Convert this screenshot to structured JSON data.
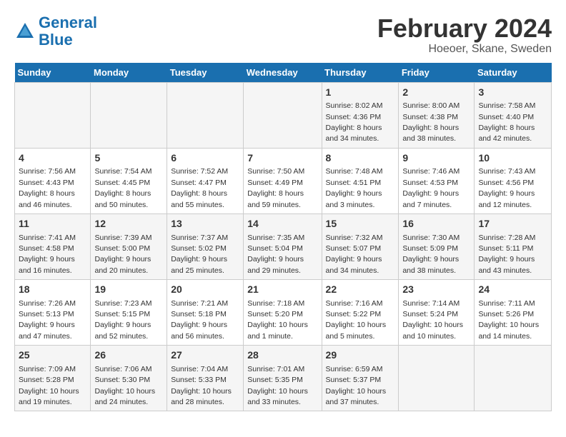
{
  "header": {
    "logo_line1": "General",
    "logo_line2": "Blue",
    "title": "February 2024",
    "subtitle": "Hoeoer, Skane, Sweden"
  },
  "weekdays": [
    "Sunday",
    "Monday",
    "Tuesday",
    "Wednesday",
    "Thursday",
    "Friday",
    "Saturday"
  ],
  "weeks": [
    [
      {
        "day": "",
        "sunrise": "",
        "sunset": "",
        "daylight": ""
      },
      {
        "day": "",
        "sunrise": "",
        "sunset": "",
        "daylight": ""
      },
      {
        "day": "",
        "sunrise": "",
        "sunset": "",
        "daylight": ""
      },
      {
        "day": "",
        "sunrise": "",
        "sunset": "",
        "daylight": ""
      },
      {
        "day": "1",
        "sunrise": "Sunrise: 8:02 AM",
        "sunset": "Sunset: 4:36 PM",
        "daylight": "Daylight: 8 hours and 34 minutes."
      },
      {
        "day": "2",
        "sunrise": "Sunrise: 8:00 AM",
        "sunset": "Sunset: 4:38 PM",
        "daylight": "Daylight: 8 hours and 38 minutes."
      },
      {
        "day": "3",
        "sunrise": "Sunrise: 7:58 AM",
        "sunset": "Sunset: 4:40 PM",
        "daylight": "Daylight: 8 hours and 42 minutes."
      }
    ],
    [
      {
        "day": "4",
        "sunrise": "Sunrise: 7:56 AM",
        "sunset": "Sunset: 4:43 PM",
        "daylight": "Daylight: 8 hours and 46 minutes."
      },
      {
        "day": "5",
        "sunrise": "Sunrise: 7:54 AM",
        "sunset": "Sunset: 4:45 PM",
        "daylight": "Daylight: 8 hours and 50 minutes."
      },
      {
        "day": "6",
        "sunrise": "Sunrise: 7:52 AM",
        "sunset": "Sunset: 4:47 PM",
        "daylight": "Daylight: 8 hours and 55 minutes."
      },
      {
        "day": "7",
        "sunrise": "Sunrise: 7:50 AM",
        "sunset": "Sunset: 4:49 PM",
        "daylight": "Daylight: 8 hours and 59 minutes."
      },
      {
        "day": "8",
        "sunrise": "Sunrise: 7:48 AM",
        "sunset": "Sunset: 4:51 PM",
        "daylight": "Daylight: 9 hours and 3 minutes."
      },
      {
        "day": "9",
        "sunrise": "Sunrise: 7:46 AM",
        "sunset": "Sunset: 4:53 PM",
        "daylight": "Daylight: 9 hours and 7 minutes."
      },
      {
        "day": "10",
        "sunrise": "Sunrise: 7:43 AM",
        "sunset": "Sunset: 4:56 PM",
        "daylight": "Daylight: 9 hours and 12 minutes."
      }
    ],
    [
      {
        "day": "11",
        "sunrise": "Sunrise: 7:41 AM",
        "sunset": "Sunset: 4:58 PM",
        "daylight": "Daylight: 9 hours and 16 minutes."
      },
      {
        "day": "12",
        "sunrise": "Sunrise: 7:39 AM",
        "sunset": "Sunset: 5:00 PM",
        "daylight": "Daylight: 9 hours and 20 minutes."
      },
      {
        "day": "13",
        "sunrise": "Sunrise: 7:37 AM",
        "sunset": "Sunset: 5:02 PM",
        "daylight": "Daylight: 9 hours and 25 minutes."
      },
      {
        "day": "14",
        "sunrise": "Sunrise: 7:35 AM",
        "sunset": "Sunset: 5:04 PM",
        "daylight": "Daylight: 9 hours and 29 minutes."
      },
      {
        "day": "15",
        "sunrise": "Sunrise: 7:32 AM",
        "sunset": "Sunset: 5:07 PM",
        "daylight": "Daylight: 9 hours and 34 minutes."
      },
      {
        "day": "16",
        "sunrise": "Sunrise: 7:30 AM",
        "sunset": "Sunset: 5:09 PM",
        "daylight": "Daylight: 9 hours and 38 minutes."
      },
      {
        "day": "17",
        "sunrise": "Sunrise: 7:28 AM",
        "sunset": "Sunset: 5:11 PM",
        "daylight": "Daylight: 9 hours and 43 minutes."
      }
    ],
    [
      {
        "day": "18",
        "sunrise": "Sunrise: 7:26 AM",
        "sunset": "Sunset: 5:13 PM",
        "daylight": "Daylight: 9 hours and 47 minutes."
      },
      {
        "day": "19",
        "sunrise": "Sunrise: 7:23 AM",
        "sunset": "Sunset: 5:15 PM",
        "daylight": "Daylight: 9 hours and 52 minutes."
      },
      {
        "day": "20",
        "sunrise": "Sunrise: 7:21 AM",
        "sunset": "Sunset: 5:18 PM",
        "daylight": "Daylight: 9 hours and 56 minutes."
      },
      {
        "day": "21",
        "sunrise": "Sunrise: 7:18 AM",
        "sunset": "Sunset: 5:20 PM",
        "daylight": "Daylight: 10 hours and 1 minute."
      },
      {
        "day": "22",
        "sunrise": "Sunrise: 7:16 AM",
        "sunset": "Sunset: 5:22 PM",
        "daylight": "Daylight: 10 hours and 5 minutes."
      },
      {
        "day": "23",
        "sunrise": "Sunrise: 7:14 AM",
        "sunset": "Sunset: 5:24 PM",
        "daylight": "Daylight: 10 hours and 10 minutes."
      },
      {
        "day": "24",
        "sunrise": "Sunrise: 7:11 AM",
        "sunset": "Sunset: 5:26 PM",
        "daylight": "Daylight: 10 hours and 14 minutes."
      }
    ],
    [
      {
        "day": "25",
        "sunrise": "Sunrise: 7:09 AM",
        "sunset": "Sunset: 5:28 PM",
        "daylight": "Daylight: 10 hours and 19 minutes."
      },
      {
        "day": "26",
        "sunrise": "Sunrise: 7:06 AM",
        "sunset": "Sunset: 5:30 PM",
        "daylight": "Daylight: 10 hours and 24 minutes."
      },
      {
        "day": "27",
        "sunrise": "Sunrise: 7:04 AM",
        "sunset": "Sunset: 5:33 PM",
        "daylight": "Daylight: 10 hours and 28 minutes."
      },
      {
        "day": "28",
        "sunrise": "Sunrise: 7:01 AM",
        "sunset": "Sunset: 5:35 PM",
        "daylight": "Daylight: 10 hours and 33 minutes."
      },
      {
        "day": "29",
        "sunrise": "Sunrise: 6:59 AM",
        "sunset": "Sunset: 5:37 PM",
        "daylight": "Daylight: 10 hours and 37 minutes."
      },
      {
        "day": "",
        "sunrise": "",
        "sunset": "",
        "daylight": ""
      },
      {
        "day": "",
        "sunrise": "",
        "sunset": "",
        "daylight": ""
      }
    ]
  ]
}
